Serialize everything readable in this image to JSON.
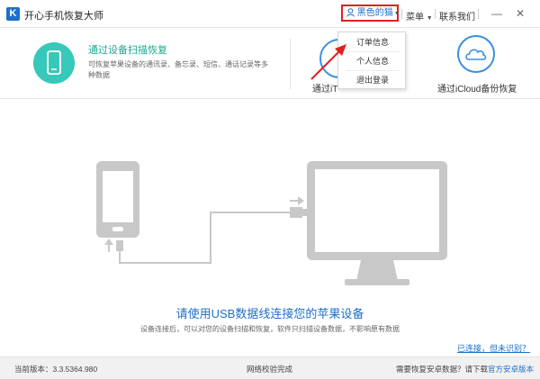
{
  "app": {
    "logo_letter": "K",
    "title": "开心手机恢复大师"
  },
  "titlebar": {
    "username": "黑色的猫",
    "menu_label": "菜单",
    "contact_label": "联系我们",
    "minimize": "—",
    "close": "✕"
  },
  "dropdown": {
    "items": [
      {
        "label": "订单信息"
      },
      {
        "label": "个人信息"
      },
      {
        "label": "退出登录"
      }
    ]
  },
  "modes": [
    {
      "title": "通过设备扫描恢复",
      "desc": "可恢复苹果设备的通讯录、备忘录、短信、通话记录等多种数据"
    },
    {
      "label": "通过iT"
    },
    {
      "label": "通过iCloud备份恢复"
    }
  ],
  "main": {
    "headline": "请使用USB数据线连接您的苹果设备",
    "subline": "设备连接后，可以对您的设备扫描和恢复，软件只扫描设备数据，不影响原有数据",
    "help_link": "已连接，但未识别？"
  },
  "statusbar": {
    "version": "当前版本：3.3.5364.980",
    "network": "网络校验完成",
    "android_prompt": "需要恢复安卓数据？请下载",
    "android_link": "官方安卓版本"
  },
  "colors": {
    "accent_blue": "#1e6fc8",
    "teal": "#36c8b9",
    "highlight_red": "#e02020",
    "illustration_gray": "#c8c8c8"
  }
}
